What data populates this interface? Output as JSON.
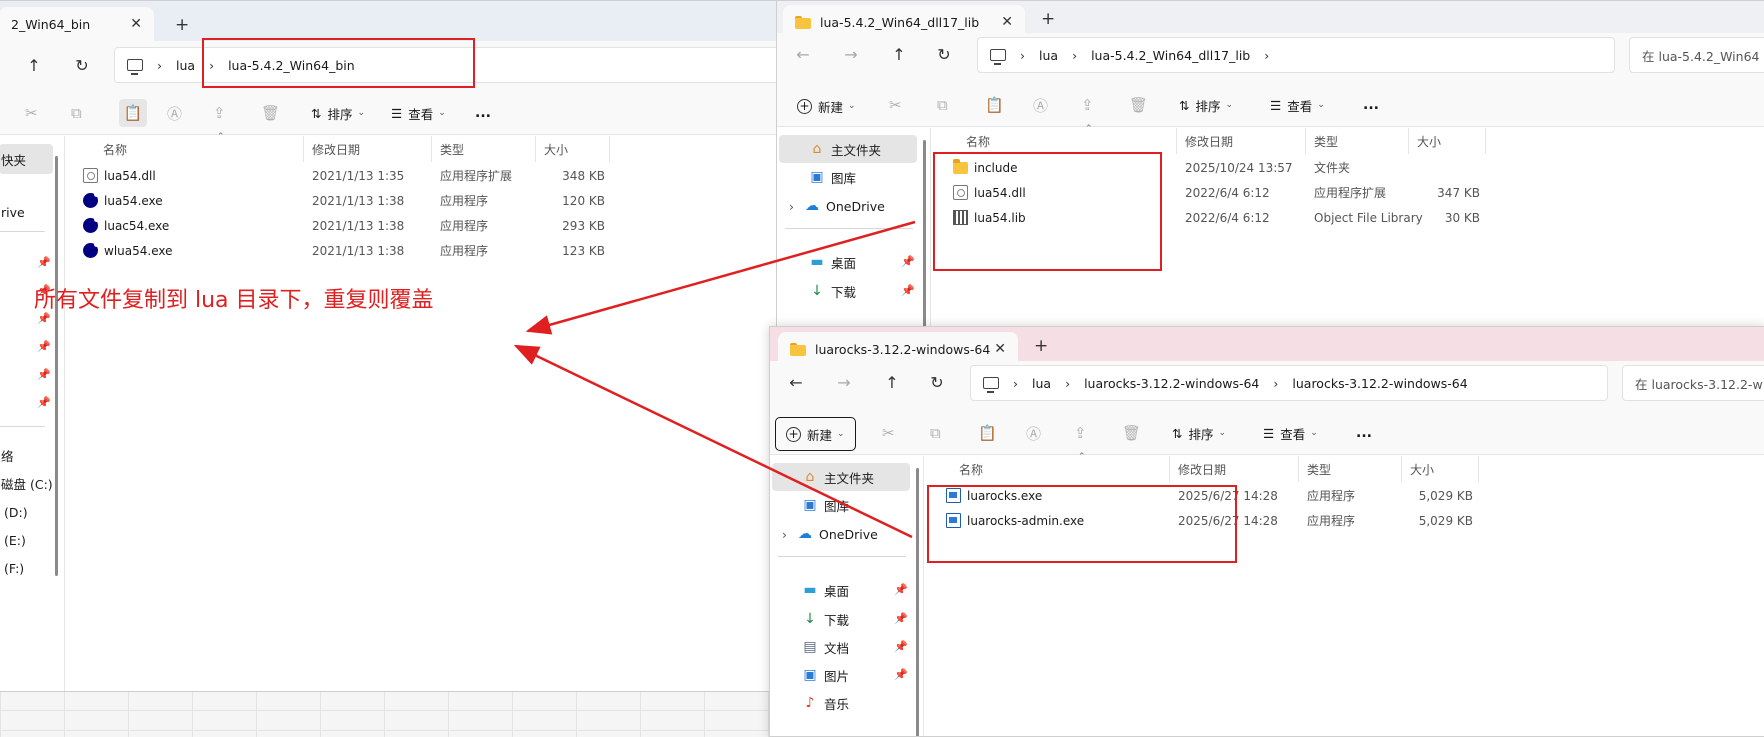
{
  "annotation": {
    "text": "所有文件复制到 lua 目录下，重复则覆盖",
    "color": "#e02020"
  },
  "window_bin": {
    "tab_title": "2_Win64_bin",
    "breadcrumb": [
      "lua",
      "lua-5.4.2_Win64_bin"
    ],
    "toolbar": {
      "sort": "排序",
      "view": "查看",
      "more": "..."
    },
    "sidebar": {
      "quick_access_partial": "快夹",
      "onedrive_partial": "rive",
      "drives": [
        "磁盘 (C:)",
        "(D:)",
        "(E:)",
        "(F:)"
      ],
      "network_partial": "络"
    },
    "columns": [
      "名称",
      "修改日期",
      "类型",
      "大小"
    ],
    "files": [
      {
        "name": "lua54.dll",
        "date": "2021/1/13 1:35",
        "type": "应用程序扩展",
        "size": "348 KB",
        "icon": "dll-icon"
      },
      {
        "name": "lua54.exe",
        "date": "2021/1/13 1:38",
        "type": "应用程序",
        "size": "120 KB",
        "icon": "lua-icon"
      },
      {
        "name": "luac54.exe",
        "date": "2021/1/13 1:38",
        "type": "应用程序",
        "size": "293 KB",
        "icon": "lua-icon"
      },
      {
        "name": "wlua54.exe",
        "date": "2021/1/13 1:38",
        "type": "应用程序",
        "size": "123 KB",
        "icon": "lua-icon"
      }
    ]
  },
  "window_dll": {
    "tab_title": "lua-5.4.2_Win64_dll17_lib",
    "breadcrumb": [
      "lua",
      "lua-5.4.2_Win64_dll17_lib"
    ],
    "search_placeholder": "在 lua-5.4.2_Win64",
    "toolbar": {
      "new": "新建",
      "sort": "排序",
      "view": "查看",
      "more": "..."
    },
    "sidebar": [
      "主文件夹",
      "图库",
      "OneDrive",
      "桌面",
      "下载"
    ],
    "columns": [
      "名称",
      "修改日期",
      "类型",
      "大小"
    ],
    "files": [
      {
        "name": "include",
        "date": "2025/10/24 13:57",
        "type": "文件夹",
        "size": "",
        "icon": "folder-icon"
      },
      {
        "name": "lua54.dll",
        "date": "2022/6/4 6:12",
        "type": "应用程序扩展",
        "size": "347 KB",
        "icon": "dll-icon"
      },
      {
        "name": "lua54.lib",
        "date": "2022/6/4 6:12",
        "type": "Object File Library",
        "size": "30 KB",
        "icon": "lib-icon"
      }
    ]
  },
  "window_luarocks": {
    "tab_title": "luarocks-3.12.2-windows-64",
    "breadcrumb": [
      "lua",
      "luarocks-3.12.2-windows-64",
      "luarocks-3.12.2-windows-64"
    ],
    "search_placeholder": "在 luarocks-3.12.2-w",
    "toolbar": {
      "new": "新建",
      "sort": "排序",
      "view": "查看",
      "more": "..."
    },
    "sidebar": [
      "主文件夹",
      "图库",
      "OneDrive",
      "桌面",
      "下载",
      "文档",
      "图片",
      "音乐"
    ],
    "columns": [
      "名称",
      "修改日期",
      "类型",
      "大小"
    ],
    "files": [
      {
        "name": "luarocks.exe",
        "date": "2025/6/27 14:28",
        "type": "应用程序",
        "size": "5,029 KB",
        "icon": "exe-icon"
      },
      {
        "name": "luarocks-admin.exe",
        "date": "2025/6/27 14:28",
        "type": "应用程序",
        "size": "5,029 KB",
        "icon": "exe-icon"
      }
    ]
  }
}
